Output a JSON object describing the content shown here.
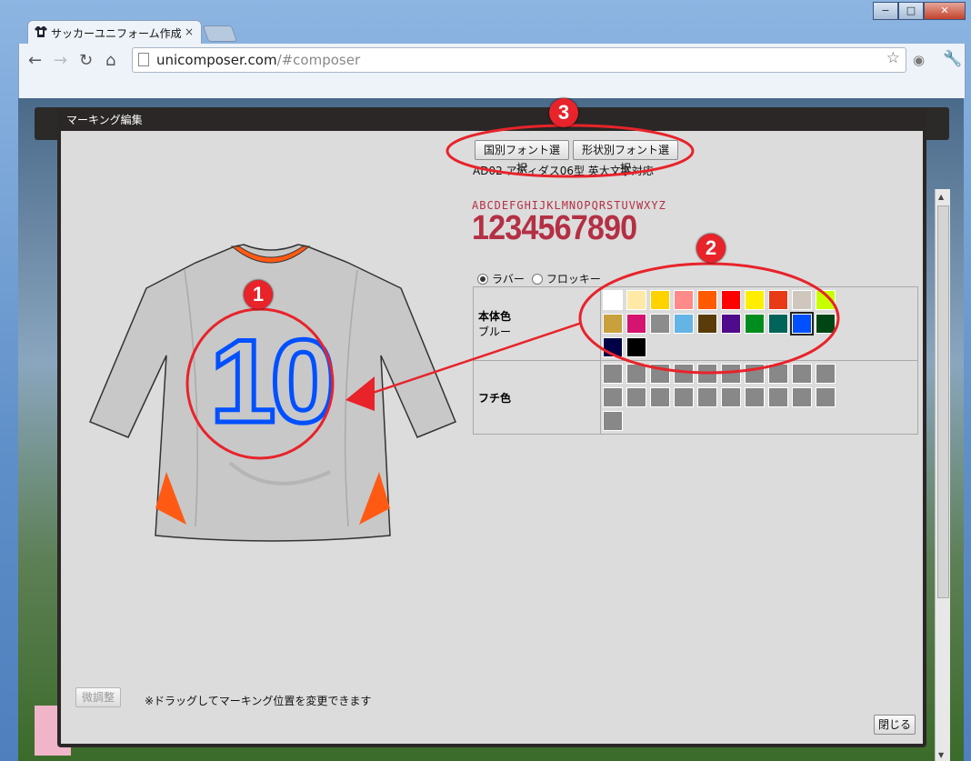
{
  "browser": {
    "tab_title": "サッカーユニフォーム作成",
    "url_host": "unicomposer.com",
    "url_path": "/#composer",
    "win_minimize": "−",
    "win_maximize": "□",
    "win_close": "✕"
  },
  "dialog": {
    "title": "マーキング編集",
    "country_font_button": "国別フォント選択",
    "shape_font_button": "形状別フォント選択",
    "font_name": "AD02 アディダス06型 英大文字対応",
    "preview_letters": "ABCDEFGHIJKLMNOPQRSTUVWXYZ",
    "preview_digits": "1234567890",
    "material_options": [
      {
        "label": "ラバー",
        "selected": true
      },
      {
        "label": "フロッキー",
        "selected": false
      }
    ],
    "body_color": {
      "label": "本体色",
      "selected_name": "ブルー",
      "swatches": [
        "#ffffff",
        "#ffe9a6",
        "#ffd200",
        "#ff8a8a",
        "#ff5a00",
        "#ff0000",
        "#ffee00",
        "#e83a14",
        "#cfc7bd",
        "#c8ff00",
        "#c8a03c",
        "#d4146e",
        "#8c8c8c",
        "#64b4e6",
        "#5a3c0a",
        "#500a8c",
        "#008c1e",
        "#00645a",
        "#0050ff",
        "#004614",
        "#000046",
        "#000000"
      ],
      "selected_index": 18
    },
    "edge_color": {
      "label": "フチ色",
      "swatch_count": 21
    },
    "fine_adjust_button": "微調整",
    "drag_note": "※ドラッグしてマーキング位置を変更できます",
    "close_button": "閉じる",
    "jersey_number": "10",
    "number_color": "#0050ff",
    "badges": [
      "1",
      "2",
      "3"
    ]
  }
}
